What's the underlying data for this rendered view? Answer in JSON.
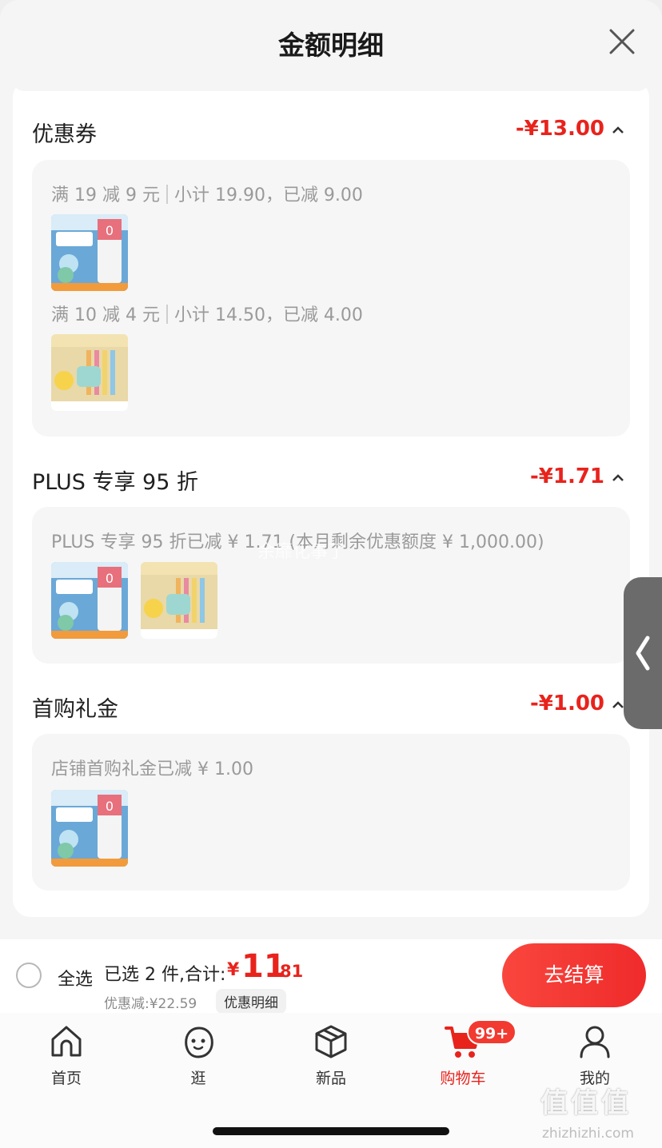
{
  "sheet": {
    "title": "金额明细",
    "close_icon": "close-icon"
  },
  "sections": [
    {
      "title": "优惠券",
      "amount": "-¥13.00",
      "rows": [
        {
          "rule": "满 19 减 9 元",
          "detail": "小计 19.90，已减 9.00",
          "products": [
            "toothpaste"
          ]
        },
        {
          "rule": "满 10 减 4 元",
          "detail": "小计 14.50，已减 4.00",
          "products": [
            "toothbrush"
          ]
        }
      ]
    },
    {
      "title": "PLUS 专享 95 折",
      "amount": "-¥1.71",
      "rows": [
        {
          "rule": "PLUS 专享 95 折已减 ¥ 1.71 (本月剩余优惠额度 ¥ 1,000.00)",
          "products": [
            "toothpaste",
            "toothbrush"
          ]
        }
      ]
    },
    {
      "title": "首购礼金",
      "amount": "-¥1.00",
      "rows": [
        {
          "rule": "店铺首购礼金已减 ¥ 1.00",
          "products": [
            "toothpaste"
          ]
        }
      ]
    }
  ],
  "watermark": "余靡化事了",
  "footer": {
    "select_all": "全选",
    "selected_count": "已选 2 件,合计:",
    "currency": "¥",
    "total_int": "11",
    "total_dec": ".81",
    "discount": "优惠减:¥22.59",
    "detail_chip": "优惠明细",
    "checkout": "去结算"
  },
  "tabs": [
    {
      "label": "首页",
      "icon": "home-icon"
    },
    {
      "label": "逛",
      "icon": "face-icon"
    },
    {
      "label": "新品",
      "icon": "box-icon"
    },
    {
      "label": "购物车",
      "icon": "cart-icon",
      "active": true,
      "badge": "99+"
    },
    {
      "label": "我的",
      "icon": "user-icon"
    }
  ],
  "site": {
    "mark": "值值值",
    "url": "zhizhizhi.com"
  },
  "colors": {
    "accent": "#e8231c",
    "checkout_gradient": [
      "#f9463d",
      "#ef2b2b"
    ]
  }
}
